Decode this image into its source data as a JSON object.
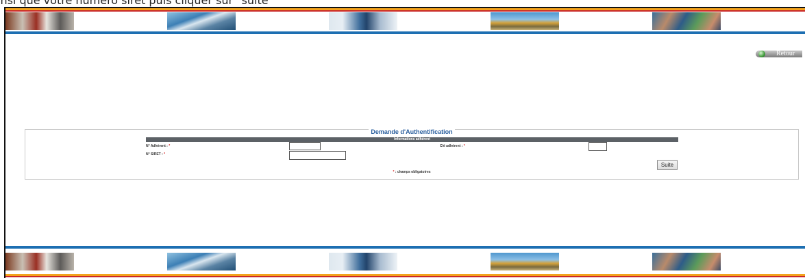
{
  "caption": "insi que votre numéro siret puis cliquer sur \"suite\"",
  "retour": {
    "label": "Retour"
  },
  "form": {
    "title": "Demande d'Authentification",
    "section_header": "Informations adhérent",
    "adherent_label": "N° Adhérent :",
    "cle_label": "Clé adhérent :",
    "siret_label": "N° SIRET :",
    "required_mark": "*",
    "adherent_value": "",
    "cle_value": "",
    "siret_value": "",
    "submit_label": "Suite",
    "mandatory_note": ": champs obligatoires"
  },
  "colors": {
    "stripe_orange": "#f3a21c",
    "stripe_red": "#c9272a",
    "stripe_blue": "#1d6fb2",
    "title_blue": "#2a5f9e",
    "required_red": "#d21a1a"
  }
}
